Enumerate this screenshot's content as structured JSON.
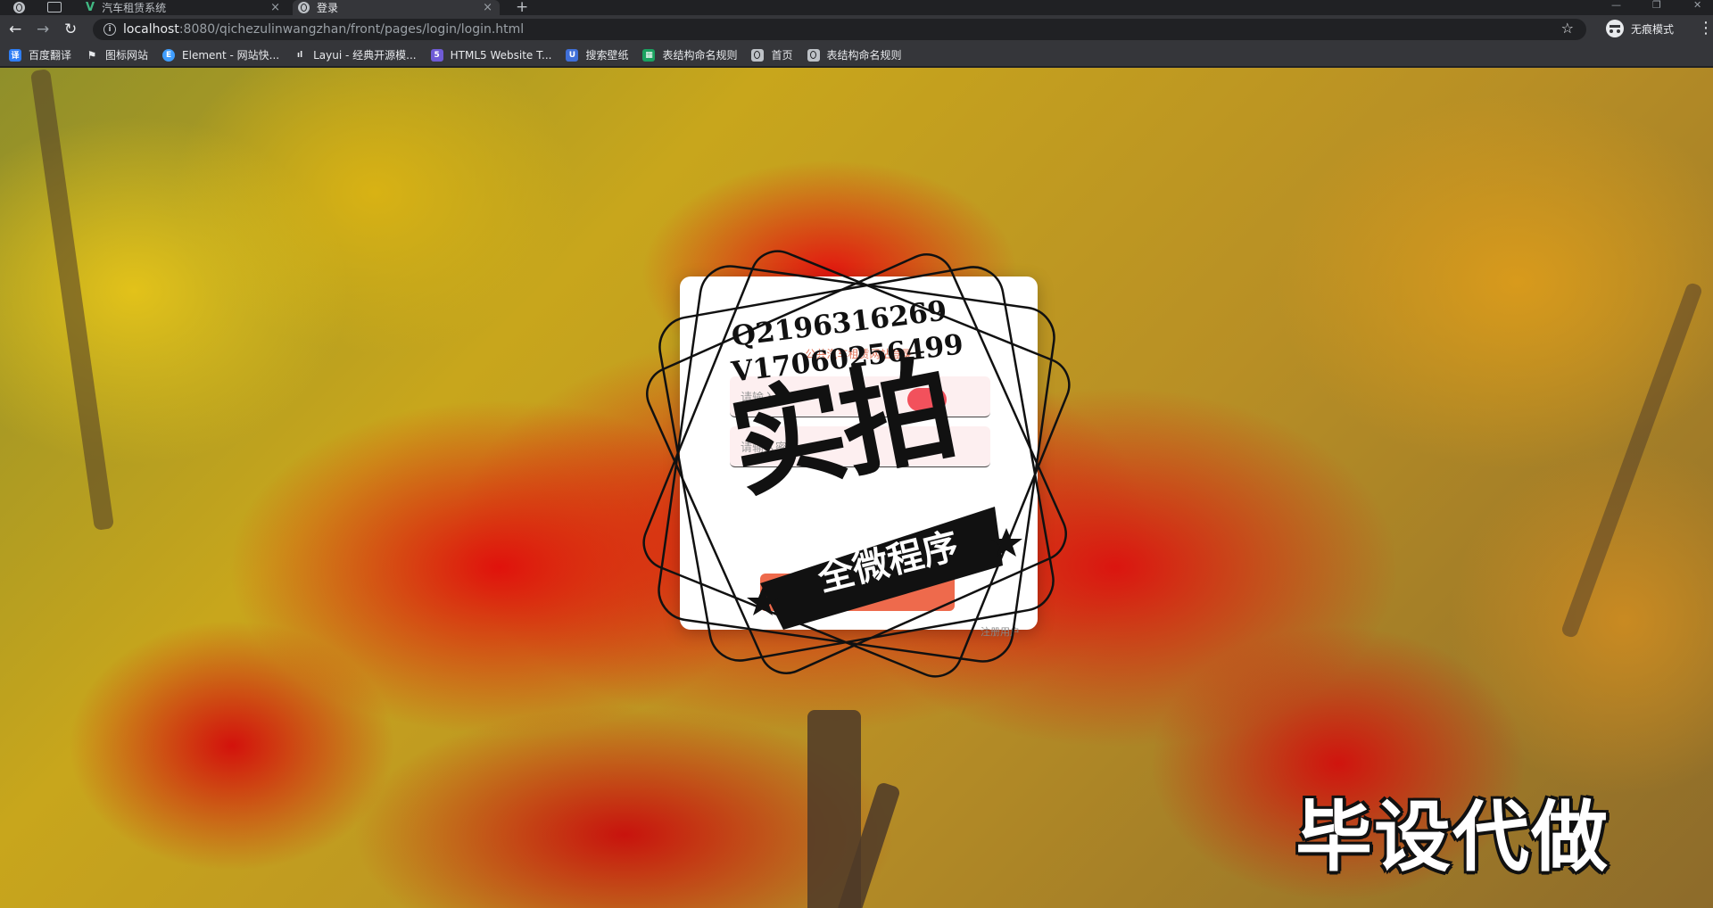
{
  "browser": {
    "tabs": [
      {
        "title": "汽车租赁系统",
        "close": "×"
      },
      {
        "title": "登录",
        "close": "×"
      }
    ],
    "new_tab": "+",
    "window_controls": {
      "minimize": "—",
      "restore": "❐",
      "close": "✕"
    },
    "nav": {
      "back": "←",
      "forward": "→",
      "reload": "↻"
    },
    "url": {
      "host": "localhost",
      "path": ":8080/qichezulinwangzhan/front/pages/login/login.html"
    },
    "incognito_label": "无痕模式",
    "menu": "⋮",
    "bookmarks": [
      {
        "label": "百度翻译",
        "icon": "baidu-translate-icon",
        "color": "#2f7ef5"
      },
      {
        "label": "图标网站",
        "icon": "flag-icon",
        "color": "#444444"
      },
      {
        "label": "Element - 网站快...",
        "icon": "element-icon",
        "color": "#409eff"
      },
      {
        "label": "Layui - 经典开源模...",
        "icon": "layui-icon",
        "color": "#555555"
      },
      {
        "label": "HTML5 Website T...",
        "icon": "html5-icon",
        "color": "#6f5bd6"
      },
      {
        "label": "搜索壁纸",
        "icon": "wallpaper-icon",
        "color": "#3f6fd8"
      },
      {
        "label": "表结构命名规则",
        "icon": "table-icon",
        "color": "#1aa260"
      },
      {
        "label": "首页",
        "icon": "globe-icon",
        "color": "#bdc1c6"
      },
      {
        "label": "表结构命名规则",
        "icon": "globe-icon",
        "color": "#bdc1c6"
      }
    ]
  },
  "login": {
    "title": "公共汽车租赁网站登录",
    "username_placeholder": "请输入账号",
    "password_placeholder": "请输入密码",
    "submit_label": "登录",
    "register_label": "注册用户"
  },
  "overlay": {
    "contact_q": "Q2196316269",
    "contact_v": "V17060256499",
    "stamp_main": "实拍",
    "stamp_ribbon": "全微程序",
    "corner_text": "毕设代做"
  }
}
